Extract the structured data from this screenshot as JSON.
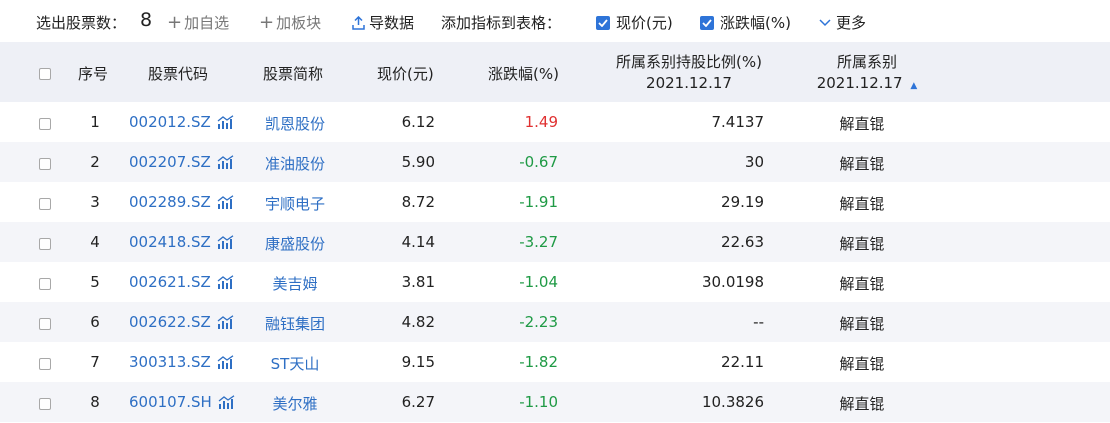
{
  "toolbar": {
    "count_label": "选出股票数：",
    "count_value": "8",
    "add_watchlist": "加自选",
    "add_sector": "加板块",
    "export": "导数据",
    "add_indicator_label": "添加指标到表格：",
    "check_price": "现价(元)",
    "check_change": "涨跌幅(%)",
    "more": "更多"
  },
  "table": {
    "headers": {
      "index": "序号",
      "code": "股票代码",
      "name": "股票简称",
      "price": "现价(元)",
      "change": "涨跌幅(%)",
      "ratio_line1": "所属系别持股比例(%)",
      "ratio_line2": "2021.12.17",
      "series_line1": "所属系别",
      "series_line2": "2021.12.17",
      "sort_arrow": "▲"
    },
    "rows": [
      {
        "index": "1",
        "code": "002012.SZ",
        "name": "凯恩股份",
        "price": "6.12",
        "change": "1.49",
        "ratio": "7.4137",
        "series": "解直锟"
      },
      {
        "index": "2",
        "code": "002207.SZ",
        "name": "准油股份",
        "price": "5.90",
        "change": "-0.67",
        "ratio": "30",
        "series": "解直锟"
      },
      {
        "index": "3",
        "code": "002289.SZ",
        "name": "宇顺电子",
        "price": "8.72",
        "change": "-1.91",
        "ratio": "29.19",
        "series": "解直锟"
      },
      {
        "index": "4",
        "code": "002418.SZ",
        "name": "康盛股份",
        "price": "4.14",
        "change": "-3.27",
        "ratio": "22.63",
        "series": "解直锟"
      },
      {
        "index": "5",
        "code": "002621.SZ",
        "name": "美吉姆",
        "price": "3.81",
        "change": "-1.04",
        "ratio": "30.0198",
        "series": "解直锟"
      },
      {
        "index": "6",
        "code": "002622.SZ",
        "name": "融钰集团",
        "price": "4.82",
        "change": "-2.23",
        "ratio": "--",
        "series": "解直锟"
      },
      {
        "index": "7",
        "code": "300313.SZ",
        "name": "ST天山",
        "price": "9.15",
        "change": "-1.82",
        "ratio": "22.11",
        "series": "解直锟"
      },
      {
        "index": "8",
        "code": "600107.SH",
        "name": "美尔雅",
        "price": "6.27",
        "change": "-1.10",
        "ratio": "10.3826",
        "series": "解直锟"
      }
    ]
  },
  "colors": {
    "accent": "#2e74d8",
    "link": "#2e6fc4",
    "up": "#e03131",
    "down": "#1f9a45",
    "header_bg": "#eef0f6",
    "row_alt_bg": "#f4f5f9"
  }
}
